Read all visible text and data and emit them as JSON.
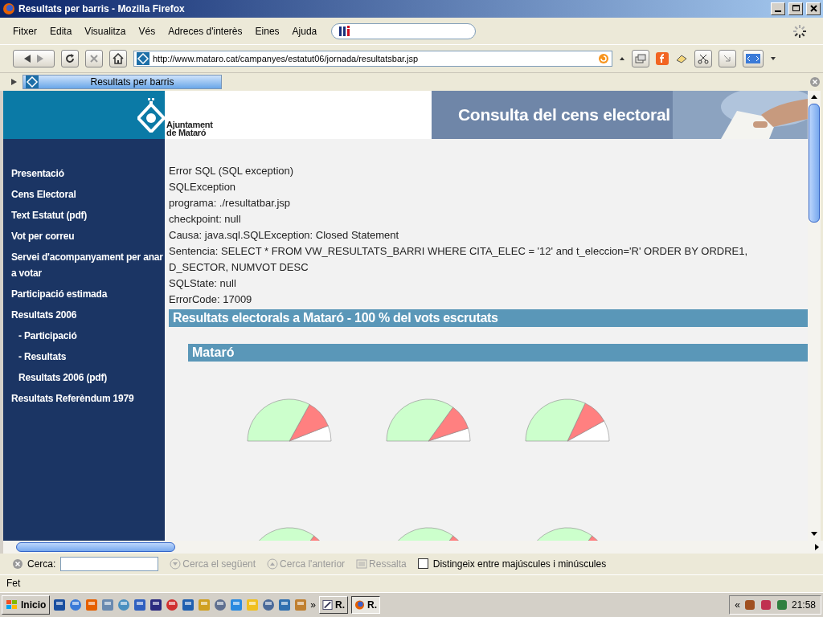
{
  "window": {
    "title": "Resultats per barris - Mozilla Firefox"
  },
  "menu": [
    "Fitxer",
    "Edita",
    "Visualitza",
    "Vés",
    "Adreces d'interès",
    "Eines",
    "Ajuda"
  ],
  "address": {
    "value": "http://www.mataro.cat/campanyes/estatut06/jornada/resultatsbar.jsp"
  },
  "tabs": [
    {
      "label": "Resultats per barris",
      "selected": true
    }
  ],
  "header": {
    "logo_lines": [
      "Ajuntament",
      "de Mataró"
    ],
    "banner": "Consulta del cens electoral"
  },
  "sidebar": {
    "items": [
      {
        "label": "Presentació"
      },
      {
        "label": "Cens Electoral"
      },
      {
        "label": "Text Estatut (pdf)"
      },
      {
        "label": "Vot per correu"
      },
      {
        "label": "Servei d'acompanyament per anar a votar"
      },
      {
        "label": "Participació estimada"
      },
      {
        "label": "Resultats 2006",
        "children": [
          {
            "label": "- Participació"
          },
          {
            "label": "- Resultats"
          },
          {
            "label": "Resultats 2006 (pdf)"
          }
        ]
      },
      {
        "label": "Resultats Referèndum 1979"
      }
    ]
  },
  "errors": [
    "Error SQL (SQL exception)",
    "SQLException",
    "programa: ./resultatbar.jsp",
    "checkpoint: null",
    "Causa: java.sql.SQLException: Closed Statement",
    "Sentencia: SELECT * FROM VW_RESULTATS_BARRI WHERE CITA_ELEC = '12' and t_eleccion='R' ORDER BY ORDRE1, D_SECTOR, NUMVOT DESC",
    "SQLState: null",
    "ErrorCode: 17009"
  ],
  "results": {
    "title": "Resultats electorals a Mataró - 100 % del vots escrutats",
    "section": "Mataró",
    "charts": [
      {
        "kind": "half-pie"
      },
      {
        "kind": "half-pie"
      },
      {
        "kind": "half-pie"
      },
      {
        "kind": "half-pie"
      },
      {
        "kind": "half-pie"
      },
      {
        "kind": "half-pie"
      }
    ]
  },
  "find_bar": {
    "label": "Cerca:",
    "next": "Cerca el següent",
    "previous": "Cerca l'anterior",
    "highlight": "Ressalta",
    "match_case": {
      "label": "Distingeix entre majúscules i minúscules",
      "checked": false
    }
  },
  "status_bar": "Fet",
  "taskbar": {
    "start": "Inicio",
    "overflow": "»",
    "tray_overflow": "«",
    "tasks": [
      {
        "label": "R.",
        "selected": false
      },
      {
        "label": "R.",
        "selected": true
      }
    ],
    "clock": "21:58"
  }
}
